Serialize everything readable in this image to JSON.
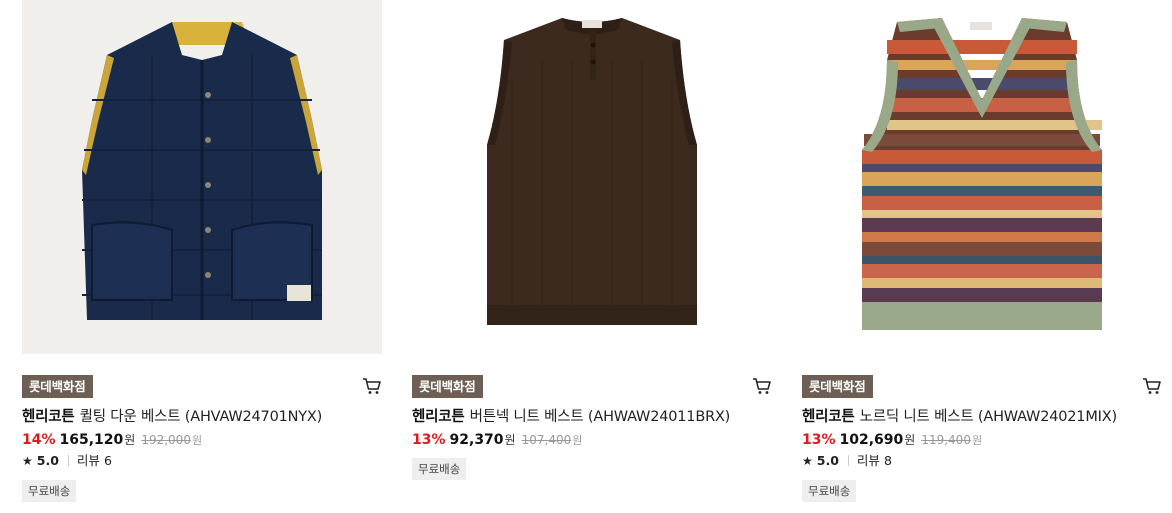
{
  "products": [
    {
      "store": "롯데백화점",
      "brand": "헨리코튼",
      "name": "퀼팅 다운 베스트 (AHVAW24701NYX)",
      "discount": "14%",
      "price": "165,120",
      "currency": "원",
      "original_price": "192,000",
      "rating": "5.0",
      "review_label": "리뷰",
      "review_count": "6",
      "shipping": "무료배송",
      "image_icon": "navy-quilted-down-vest"
    },
    {
      "store": "롯데백화점",
      "brand": "헨리코튼",
      "name": "버튼넥 니트 베스트 (AHWAW24011BRX)",
      "discount": "13%",
      "price": "92,370",
      "currency": "원",
      "original_price": "107,400",
      "shipping": "무료배송",
      "image_icon": "brown-button-neck-knit-vest"
    },
    {
      "store": "롯데백화점",
      "brand": "헨리코튼",
      "name": "노르딕 니트 베스트 (AHWAW24021MIX)",
      "discount": "13%",
      "price": "102,690",
      "currency": "원",
      "original_price": "119,400",
      "rating": "5.0",
      "review_label": "리뷰",
      "review_count": "8",
      "shipping": "무료배송",
      "image_icon": "nordic-pattern-knit-vest"
    }
  ],
  "colors": {
    "store_badge": "#6e5f55",
    "discount": "#e0191f",
    "ship_badge": "#eeeeee"
  },
  "icons": {
    "cart": "cart-icon",
    "star": "star-icon"
  }
}
